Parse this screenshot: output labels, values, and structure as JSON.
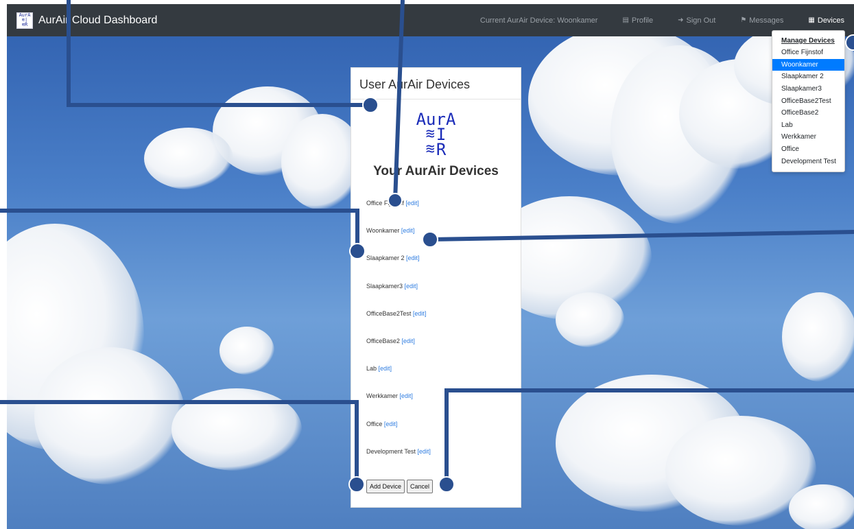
{
  "navbar": {
    "brand_title": "AurAir Cloud Dashboard",
    "logo_text": "AurA IR",
    "current_device": "Current AurAir Device: Woonkamer",
    "profile": "Profile",
    "sign_out": "Sign Out",
    "messages": "Messages",
    "devices": "Devices"
  },
  "dropdown": {
    "header": "Manage Devices",
    "items": [
      "Office Fijnstof",
      "Woonkamer",
      "Slaapkamer 2",
      "Slaapkamer3",
      "OfficeBase2Test",
      "OfficeBase2",
      "Lab",
      "Werkkamer",
      "Office",
      "Development Test"
    ],
    "active_item": "Woonkamer"
  },
  "card": {
    "header": "User AurAir Devices",
    "logo_line1": "AurA",
    "logo_line2": "I",
    "logo_line3": "R",
    "title": "Your AurAir Devices",
    "devices": [
      {
        "name": "Office Fijnstof",
        "edit": "[edit]"
      },
      {
        "name": "Woonkamer",
        "edit": "[edit]"
      },
      {
        "name": "Slaapkamer 2",
        "edit": "[edit]"
      },
      {
        "name": "Slaapkamer3",
        "edit": "[edit]"
      },
      {
        "name": "OfficeBase2Test",
        "edit": "[edit]"
      },
      {
        "name": "OfficeBase2",
        "edit": "[edit]"
      },
      {
        "name": "Lab",
        "edit": "[edit]"
      },
      {
        "name": "Werkkamer",
        "edit": "[edit]"
      },
      {
        "name": "Office",
        "edit": "[edit]"
      },
      {
        "name": "Development Test",
        "edit": "[edit]"
      }
    ],
    "add_button": "Add Device",
    "cancel_button": "Cancel"
  },
  "colors": {
    "navbar_bg": "#343a40",
    "accent": "#007bff",
    "link": "#2f7de1",
    "annotation": "#2a4f8f",
    "logo_blue": "#1a2bb8"
  },
  "icons": {
    "profile": "id-card-icon",
    "sign_out": "sign-out-icon",
    "messages": "bell-icon",
    "devices": "sitemap-icon"
  }
}
